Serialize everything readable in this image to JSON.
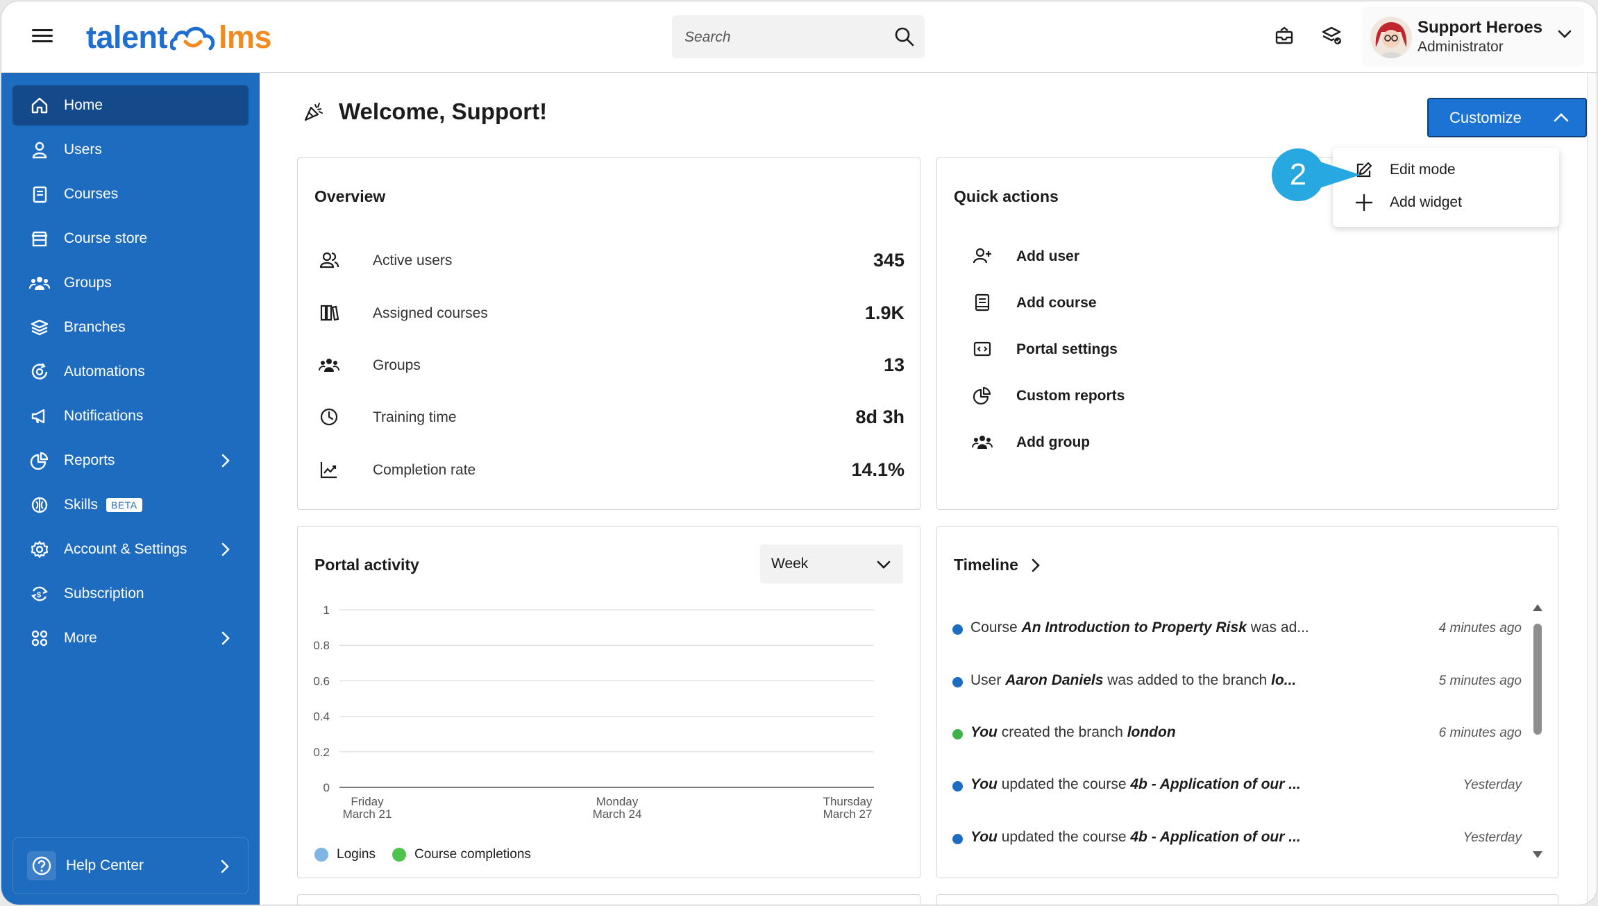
{
  "header": {
    "logo_left": "talent",
    "logo_right": "lms",
    "search_placeholder": "Search",
    "user_name": "Support Heroes",
    "user_role": "Administrator"
  },
  "colors": {
    "sidebar": "#1d6cc0",
    "sidebar_active": "#154a8a",
    "brand_blue": "#1f6fd0",
    "brand_orange": "#f28a1f",
    "primary_button": "#1d73d4",
    "step_badge": "#27a8e0",
    "timeline_blue": "#1d6cc0",
    "timeline_green": "#3fb24a",
    "logins": "#7fb6e6",
    "completions": "#4fc24f"
  },
  "sidebar": {
    "items": [
      {
        "label": "Home",
        "icon": "home-icon"
      },
      {
        "label": "Users",
        "icon": "user-icon"
      },
      {
        "label": "Courses",
        "icon": "book-icon"
      },
      {
        "label": "Course store",
        "icon": "store-icon"
      },
      {
        "label": "Groups",
        "icon": "groups-icon"
      },
      {
        "label": "Branches",
        "icon": "layers-icon"
      },
      {
        "label": "Automations",
        "icon": "automation-icon"
      },
      {
        "label": "Notifications",
        "icon": "megaphone-icon"
      },
      {
        "label": "Reports",
        "icon": "pie-chart-icon"
      },
      {
        "label": "Skills",
        "icon": "brain-icon",
        "badge": "BETA"
      },
      {
        "label": "Account & Settings",
        "icon": "gear-icon"
      },
      {
        "label": "Subscription",
        "icon": "subscription-icon"
      },
      {
        "label": "More",
        "icon": "grid-icon"
      }
    ],
    "help_label": "Help Center"
  },
  "main": {
    "welcome": "Welcome, Support!",
    "customize_label": "Customize",
    "customize_menu": [
      {
        "label": "Edit mode",
        "icon": "edit-icon"
      },
      {
        "label": "Add widget",
        "icon": "plus-icon"
      }
    ],
    "step_number": "2"
  },
  "overview": {
    "title": "Overview",
    "rows": [
      {
        "label": "Active users",
        "value": "345",
        "icon": "users-icon"
      },
      {
        "label": "Assigned courses",
        "value": "1.9K",
        "icon": "books-icon"
      },
      {
        "label": "Groups",
        "value": "13",
        "icon": "groups-icon"
      },
      {
        "label": "Training time",
        "value": "8d 3h",
        "icon": "clock-icon"
      },
      {
        "label": "Completion rate",
        "value": "14.1%",
        "icon": "trend-icon"
      }
    ]
  },
  "quick_actions": {
    "title": "Quick actions",
    "items": [
      {
        "label": "Add user",
        "icon": "add-user-icon"
      },
      {
        "label": "Add course",
        "icon": "book-icon"
      },
      {
        "label": "Portal settings",
        "icon": "code-icon"
      },
      {
        "label": "Custom reports",
        "icon": "pie-chart-icon"
      },
      {
        "label": "Add group",
        "icon": "groups-icon"
      }
    ]
  },
  "portal_activity": {
    "title": "Portal activity",
    "period": "Week",
    "legend": [
      "Logins",
      "Course completions"
    ]
  },
  "chart_data": {
    "type": "line",
    "x": [
      "Friday March 21",
      "Monday March 24",
      "Thursday March 27"
    ],
    "x_ticks": [
      {
        "day": "Friday",
        "date": "March 21"
      },
      {
        "day": "Monday",
        "date": "March 24"
      },
      {
        "day": "Thursday",
        "date": "March 27"
      }
    ],
    "y_ticks": [
      "1",
      "0.8",
      "0.6",
      "0.4",
      "0.2",
      "0"
    ],
    "ylim": [
      0,
      1
    ],
    "series": [
      {
        "name": "Logins",
        "values": []
      },
      {
        "name": "Course completions",
        "values": []
      }
    ],
    "grid": true,
    "legend_position": "bottom-left"
  },
  "timeline": {
    "title": "Timeline",
    "entries": [
      {
        "pre": "Course ",
        "em": "An Introduction to Property Risk",
        "post": " was ad...",
        "em2": "",
        "time": "4 minutes ago",
        "color": "blue"
      },
      {
        "pre": "User ",
        "em": "Aaron Daniels",
        "post": " was added to the branch ",
        "em2": "lo...",
        "time": "5 minutes ago",
        "color": "blue"
      },
      {
        "pre": "",
        "em": "You",
        "post": " created the branch ",
        "em2": "london",
        "time": "6 minutes ago",
        "color": "green"
      },
      {
        "pre": "",
        "em": "You",
        "post": " updated the course ",
        "em2": "4b - Application of our ...",
        "time": "Yesterday",
        "color": "blue"
      },
      {
        "pre": "",
        "em": "You",
        "post": " updated the course ",
        "em2": "4b - Application of our ...",
        "time": "Yesterday",
        "color": "blue"
      }
    ]
  }
}
